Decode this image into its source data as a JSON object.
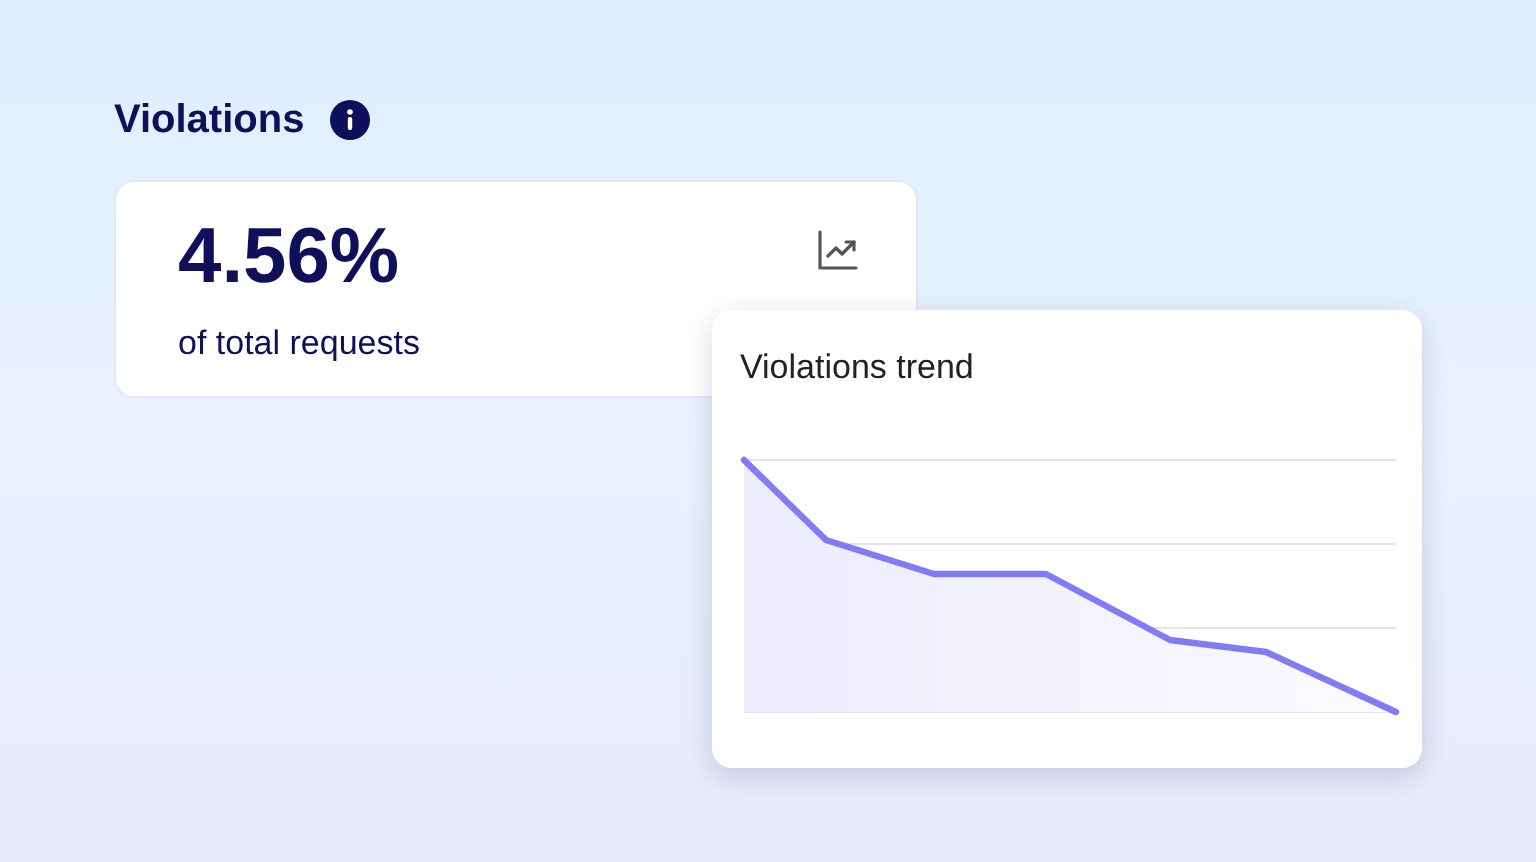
{
  "section": {
    "title": "Violations"
  },
  "metric": {
    "value": "4.56%",
    "caption": "of total requests"
  },
  "popup": {
    "title": "Violations trend"
  }
}
